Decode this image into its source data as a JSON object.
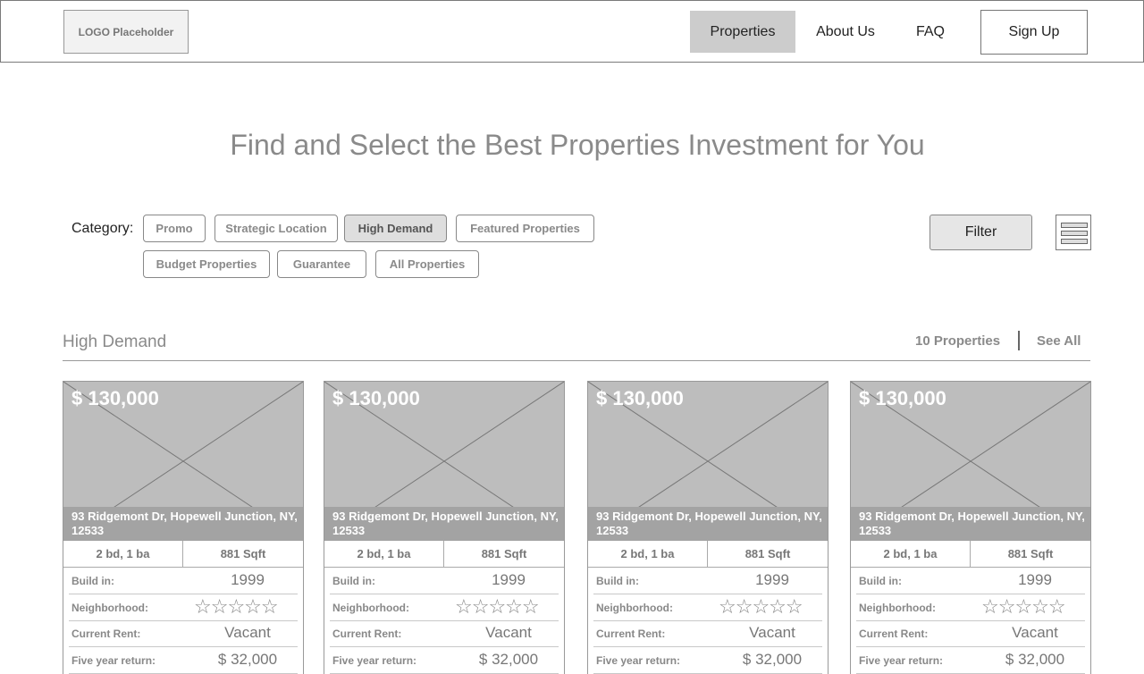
{
  "header": {
    "logo_text": "LOGO Placeholder",
    "nav": {
      "properties": "Properties",
      "about": "About Us",
      "faq": "FAQ",
      "signup": "Sign Up"
    }
  },
  "hero": {
    "title": "Find and Select the Best Properties Investment for You"
  },
  "categories": {
    "label": "Category:",
    "chips": [
      "Promo",
      "Strategic Location",
      "High Demand",
      "Featured Properties",
      "Budget Properties",
      "Guarantee",
      "All Properties"
    ],
    "active": "High Demand",
    "filter_label": "Filter",
    "view_toggle_icon": "list-view-icon"
  },
  "section": {
    "title": "High Demand",
    "count": "10 Properties",
    "see_all": "See All"
  },
  "labels": {
    "build_in": "Build in:",
    "neighborhood": "Neighborhood:",
    "current_rent": "Current Rent:",
    "five_year_return": "Five year return:"
  },
  "cards": [
    {
      "price": "$ 130,000",
      "address": "93 Ridgemont Dr, Hopewell Junction, NY, 12533",
      "beds_baths": "2 bd, 1 ba",
      "sqft": "881 Sqft",
      "build_year": "1999",
      "neighborhood_rating": "☆☆☆☆☆",
      "current_rent": "Vacant",
      "five_year_return": "$ 32,000"
    },
    {
      "price": "$ 130,000",
      "address": "93 Ridgemont Dr, Hopewell Junction, NY, 12533",
      "beds_baths": "2 bd, 1 ba",
      "sqft": "881 Sqft",
      "build_year": "1999",
      "neighborhood_rating": "☆☆☆☆☆",
      "current_rent": "Vacant",
      "five_year_return": "$ 32,000"
    },
    {
      "price": "$ 130,000",
      "address": "93 Ridgemont Dr, Hopewell Junction, NY, 12533",
      "beds_baths": "2 bd, 1 ba",
      "sqft": "881 Sqft",
      "build_year": "1999",
      "neighborhood_rating": "☆☆☆☆☆",
      "current_rent": "Vacant",
      "five_year_return": "$ 32,000"
    },
    {
      "price": "$ 130,000",
      "address": "93 Ridgemont Dr, Hopewell Junction, NY, 12533",
      "beds_baths": "2 bd, 1 ba",
      "sqft": "881 Sqft",
      "build_year": "1999",
      "neighborhood_rating": "☆☆☆☆☆",
      "current_rent": "Vacant",
      "five_year_return": "$ 32,000"
    }
  ]
}
